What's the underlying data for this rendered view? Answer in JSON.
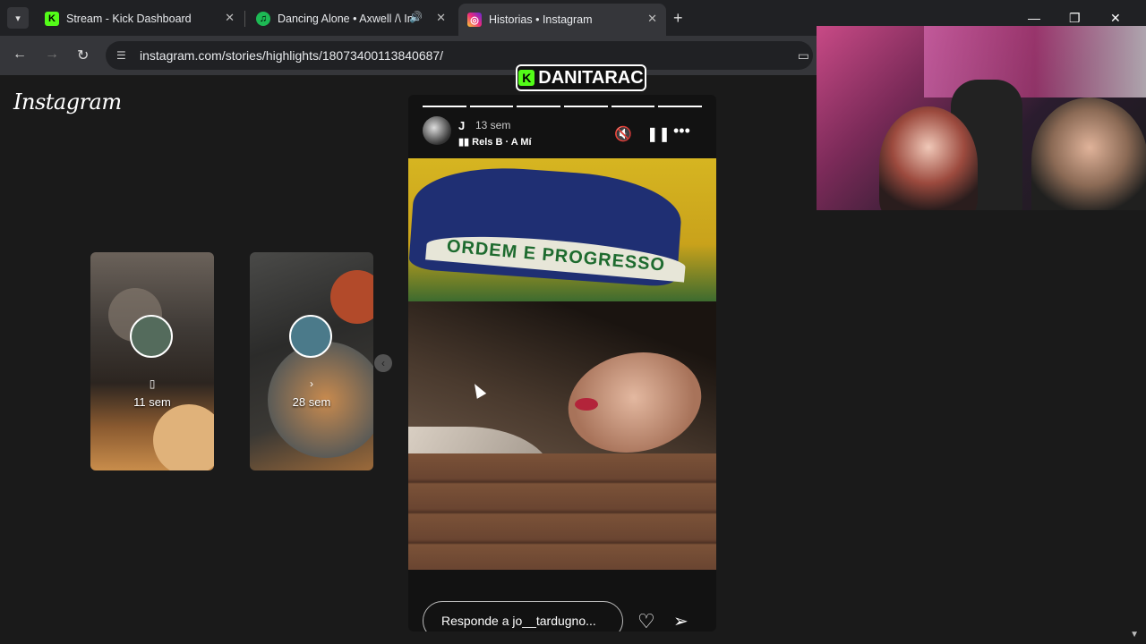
{
  "browser": {
    "tabs": [
      {
        "title": "Stream - Kick Dashboard",
        "favicon": "kick-icon",
        "favicon_glyph": "K",
        "color": "#53fc18"
      },
      {
        "title": "Dancing Alone • Axwell /\\ Ingrosso",
        "favicon": "spotify-icon",
        "favicon_glyph": "♫",
        "color": "#1db954"
      },
      {
        "title": "Historias • Instagram",
        "favicon": "instagram-icon",
        "favicon_glyph": "◎",
        "color": "#e1306c"
      }
    ],
    "new_tab": "+",
    "url": "instagram.com/stories/highlights/18073400113840687/"
  },
  "page": {
    "logo": "Instagram",
    "previews": [
      {
        "time": "11 sem",
        "icon": "▯"
      },
      {
        "time": "28 sem",
        "icon": "›"
      }
    ]
  },
  "story": {
    "user": "J",
    "time": "13 sem",
    "music": "Rels B · A Mí",
    "flag_text": "ORDEM E PROGRESSO",
    "reply_placeholder": "Responde a jo__tardugno...",
    "progress_done": 6,
    "progress_total": 6
  },
  "stream": {
    "channel": "DANITARAC",
    "badge": "K",
    "badge_color": "#53fc18"
  }
}
